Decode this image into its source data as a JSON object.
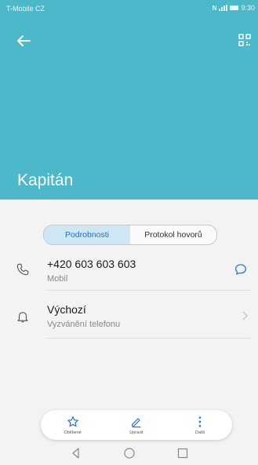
{
  "status_bar": {
    "carrier": "T-Mobile CZ",
    "nfc": "N",
    "time": "9:30"
  },
  "header": {
    "contact_name": "Kapitán",
    "background_color": "#4cb8c9",
    "back_icon": "arrow-left-icon",
    "qr_icon": "qr-code-icon"
  },
  "tabs": [
    {
      "label": "Podrobnosti",
      "active": true
    },
    {
      "label": "Protokol hovorů",
      "active": false
    }
  ],
  "phone_entry": {
    "number": "+420 603 603 603",
    "type": "Mobil",
    "icon": "phone-icon",
    "action_icon": "message-icon"
  },
  "ringtone_entry": {
    "title": "Výchozí",
    "subtitle": "Vyzvánění telefonu",
    "icon": "bell-icon"
  },
  "actions": [
    {
      "label": "Oblíbené",
      "icon": "star-icon"
    },
    {
      "label": "Upravit",
      "icon": "pencil-icon"
    },
    {
      "label": "Další",
      "icon": "more-vertical-icon"
    }
  ],
  "accent_color": "#1a73c8"
}
